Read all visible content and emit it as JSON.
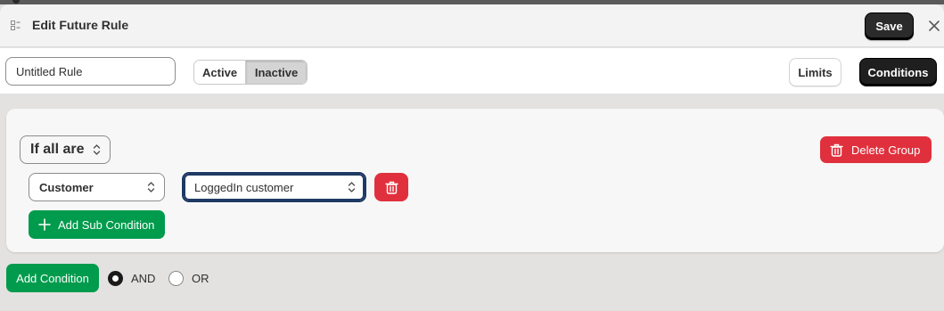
{
  "header": {
    "title": "Edit Future Rule",
    "save_label": "Save",
    "close_icon": "close-icon",
    "app_icon": "app-icon"
  },
  "toolbar": {
    "rule_name_value": "Untitled Rule",
    "status_options": [
      "Active",
      "Inactive"
    ],
    "status_selected": "Inactive",
    "limits_label": "Limits",
    "conditions_label": "Conditions"
  },
  "group": {
    "match_select": "If all are",
    "delete_group_label": "Delete Group",
    "conditions": [
      {
        "field": "Customer",
        "value": "LoggedIn customer"
      }
    ],
    "add_sub_label": "Add Sub Condition"
  },
  "footer": {
    "add_condition_label": "Add Condition",
    "logic_options": [
      "AND",
      "OR"
    ],
    "logic_selected": "AND"
  },
  "colors": {
    "primary_dark": "#1f1f1f",
    "danger": "#e0303d",
    "success": "#009b4c",
    "focus_ring": "#1f3a63"
  }
}
